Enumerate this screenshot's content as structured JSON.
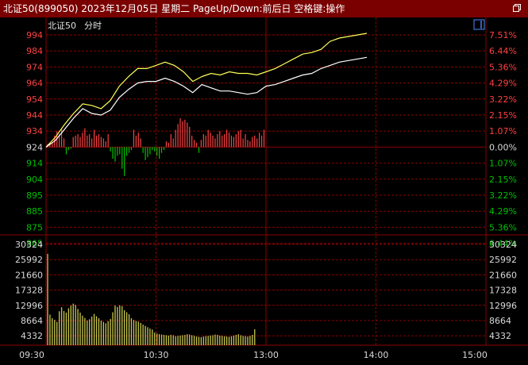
{
  "title": "北证50(899050) 2023年12月05日 星期二 PageUp/Down:前后日 空格键:操作",
  "legend": {
    "name": "北证50",
    "mode": "分时"
  },
  "colors": {
    "bg": "#000000",
    "grid": "#8b0000",
    "up": "#ff4040",
    "down": "#00c000",
    "price_white": "#ffffff",
    "price_yellow": "#ffff55",
    "volume": "#c8c850",
    "axis_text_white": "#d8d8d8",
    "titlebar": "#7a0000"
  },
  "icons": {
    "restore": "window-restore-icon",
    "toggle": "panel-toggle-icon"
  },
  "chart_data": {
    "type": "line",
    "price_axis": {
      "ticks": [
        994,
        984,
        974,
        964,
        954,
        944,
        934,
        924,
        914,
        904,
        895,
        885,
        875,
        865
      ],
      "base": 924
    },
    "pct_axis": {
      "ticks": [
        "7.51%",
        "6.44%",
        "5.36%",
        "4.29%",
        "3.22%",
        "2.15%",
        "1.07%",
        "0.00%",
        "1.07%",
        "2.15%",
        "3.22%",
        "4.29%",
        "5.36%",
        "6.44%"
      ]
    },
    "volume_axis": {
      "ticks": [
        30324,
        25992,
        21660,
        17328,
        12996,
        8664,
        4332
      ]
    },
    "time_labels": [
      "09:30",
      "10:30",
      "13:00",
      "14:00",
      "15:00"
    ],
    "x_range": [
      0,
      240
    ],
    "series": [
      {
        "color": "yellow",
        "points": [
          [
            0,
            924
          ],
          [
            5,
            930
          ],
          [
            10,
            938
          ],
          [
            15,
            945
          ],
          [
            20,
            951
          ],
          [
            25,
            950
          ],
          [
            30,
            948
          ],
          [
            35,
            953
          ],
          [
            40,
            962
          ],
          [
            45,
            968
          ],
          [
            50,
            973
          ],
          [
            55,
            973
          ],
          [
            60,
            975
          ],
          [
            65,
            977
          ],
          [
            70,
            975
          ],
          [
            75,
            971
          ],
          [
            80,
            965
          ],
          [
            85,
            968
          ],
          [
            90,
            970
          ],
          [
            95,
            969
          ],
          [
            100,
            971
          ],
          [
            105,
            970
          ],
          [
            110,
            970
          ],
          [
            115,
            969
          ],
          [
            120,
            971
          ],
          [
            125,
            973
          ],
          [
            130,
            976
          ],
          [
            135,
            979
          ],
          [
            140,
            982
          ],
          [
            145,
            983
          ],
          [
            150,
            985
          ],
          [
            155,
            990
          ],
          [
            160,
            992
          ],
          [
            165,
            993
          ],
          [
            170,
            994
          ],
          [
            175,
            995
          ]
        ]
      },
      {
        "color": "white",
        "points": [
          [
            0,
            924
          ],
          [
            5,
            928
          ],
          [
            10,
            935
          ],
          [
            15,
            942
          ],
          [
            20,
            948
          ],
          [
            25,
            945
          ],
          [
            30,
            944
          ],
          [
            35,
            947
          ],
          [
            40,
            955
          ],
          [
            45,
            960
          ],
          [
            50,
            964
          ],
          [
            55,
            965
          ],
          [
            60,
            965
          ],
          [
            65,
            967
          ],
          [
            70,
            965
          ],
          [
            75,
            962
          ],
          [
            80,
            958
          ],
          [
            85,
            963
          ],
          [
            90,
            961
          ],
          [
            95,
            959
          ],
          [
            100,
            959
          ],
          [
            105,
            958
          ],
          [
            110,
            957
          ],
          [
            115,
            958
          ],
          [
            120,
            962
          ],
          [
            125,
            963
          ],
          [
            130,
            965
          ],
          [
            135,
            967
          ],
          [
            140,
            969
          ],
          [
            145,
            970
          ],
          [
            150,
            973
          ],
          [
            155,
            975
          ],
          [
            160,
            977
          ],
          [
            165,
            978
          ],
          [
            170,
            979
          ],
          [
            175,
            980
          ]
        ]
      }
    ],
    "buysell_bars": [
      2,
      3,
      3,
      8,
      11,
      9,
      13,
      6,
      -5,
      -2,
      -1,
      7,
      8,
      9,
      7,
      10,
      13,
      8,
      9,
      6,
      12,
      8,
      9,
      7,
      6,
      4,
      9,
      -3,
      -8,
      -10,
      -6,
      -5,
      -15,
      -20,
      -6,
      -4,
      -2,
      12,
      8,
      10,
      6,
      -4,
      -9,
      -7,
      -5,
      -2,
      -3,
      -6,
      -8,
      -4,
      -2,
      4,
      3,
      9,
      6,
      12,
      16,
      20,
      18,
      19,
      17,
      14,
      8,
      5,
      3,
      -4,
      5,
      9,
      8,
      12,
      10,
      8,
      6,
      9,
      11,
      8,
      9,
      12,
      10,
      8,
      7,
      9,
      11,
      12,
      6,
      9,
      5,
      4,
      7,
      8,
      6,
      10,
      8,
      12
    ],
    "volume": [
      27500,
      9200,
      8100,
      7600,
      7000,
      10200,
      11400,
      10300,
      9800,
      11100,
      11900,
      12500,
      12100,
      10900,
      9800,
      8900,
      8200,
      7400,
      7800,
      8600,
      9400,
      8700,
      8100,
      7400,
      7000,
      6600,
      7200,
      7900,
      9900,
      11900,
      11500,
      12000,
      11700,
      10500,
      9900,
      9300,
      8100,
      7600,
      7300,
      7100,
      6700,
      6200,
      5800,
      5400,
      5000,
      4700,
      3800,
      3500,
      3300,
      3200,
      3100,
      3000,
      2900,
      3100,
      3000,
      2700,
      2800,
      2900,
      3000,
      3100,
      3300,
      3200,
      3000,
      2800,
      2600,
      2500,
      2400,
      2600,
      2700,
      2800,
      2900,
      3000,
      3200,
      3100,
      2900,
      2800,
      2700,
      2600,
      2500,
      2700,
      2900,
      3100,
      3300,
      3000,
      2800,
      2700,
      2600,
      2800,
      3100,
      4800
    ]
  }
}
